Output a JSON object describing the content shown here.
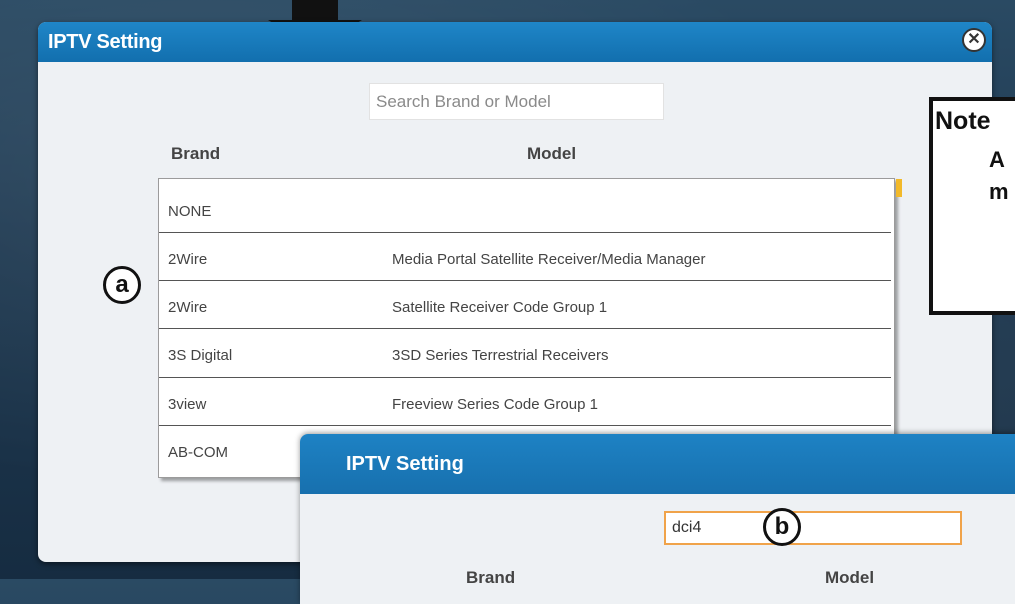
{
  "main_dialog": {
    "title": "IPTV Setting",
    "close_glyph": "✕",
    "search_placeholder": "Search Brand or Model",
    "headers": {
      "brand": "Brand",
      "model": "Model"
    },
    "rows": [
      {
        "brand": "NONE",
        "model": ""
      },
      {
        "brand": "2Wire",
        "model": "Media Portal Satellite Receiver/Media Manager"
      },
      {
        "brand": "2Wire",
        "model": "Satellite Receiver Code Group 1"
      },
      {
        "brand": "3S Digital",
        "model": "3SD Series Terrestrial Receivers"
      },
      {
        "brand": "3view",
        "model": "Freeview Series Code Group 1"
      },
      {
        "brand": "AB-COM",
        "model": ""
      }
    ]
  },
  "annotations": {
    "badge_a": "a",
    "badge_b": "b",
    "note": {
      "title": "Note",
      "line2": "A",
      "line3": "m"
    }
  },
  "second_dialog": {
    "title": "IPTV Setting",
    "search_value": "dci4",
    "headers": {
      "brand": "Brand",
      "model": "Model"
    }
  },
  "colors": {
    "header_blue": "#1f86c8",
    "scroll_accent": "#f2b92a",
    "focus_border": "#f0a34a"
  }
}
